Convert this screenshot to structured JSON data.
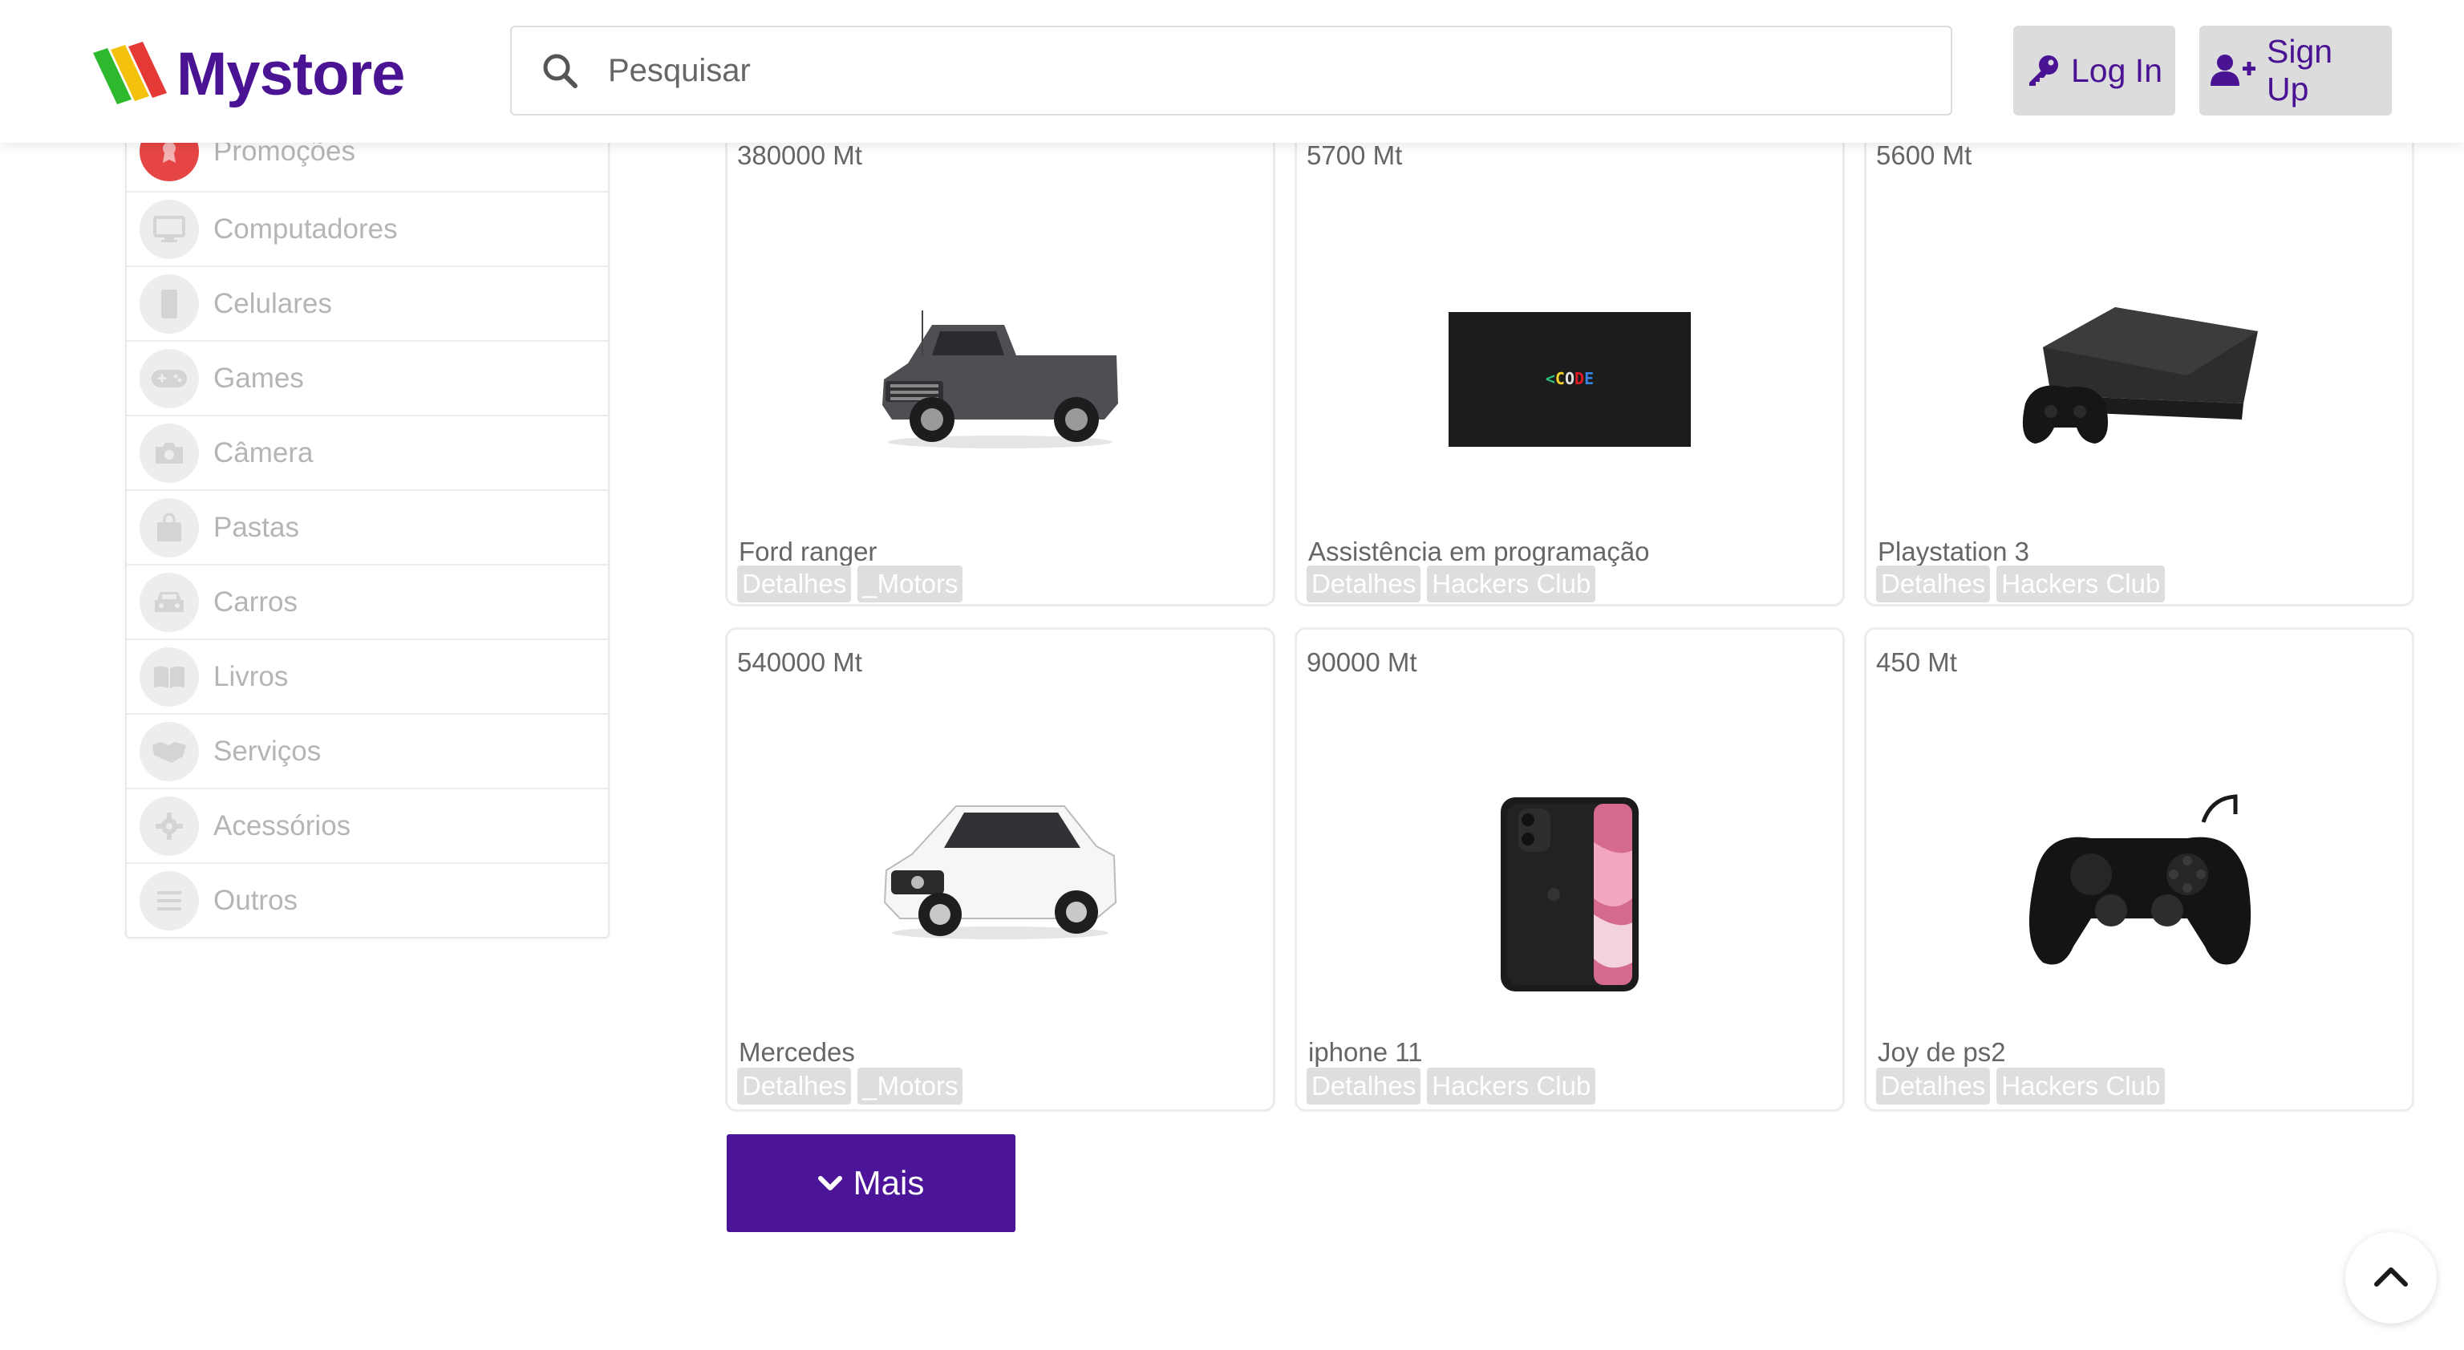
{
  "header": {
    "logo_text": "Mystore",
    "search_placeholder": "Pesquisar",
    "login_label": "Log In",
    "signup_label": "Sign Up"
  },
  "sidebar": {
    "items": [
      {
        "label": "Promoções",
        "icon": "award-icon"
      },
      {
        "label": "Computadores",
        "icon": "monitor-icon"
      },
      {
        "label": "Celulares",
        "icon": "mobile-icon"
      },
      {
        "label": "Games",
        "icon": "gamepad-icon"
      },
      {
        "label": "Câmera",
        "icon": "camera-icon"
      },
      {
        "label": "Pastas",
        "icon": "bag-icon"
      },
      {
        "label": "Carros",
        "icon": "car-icon"
      },
      {
        "label": "Livros",
        "icon": "book-icon"
      },
      {
        "label": "Serviços",
        "icon": "handshake-icon"
      },
      {
        "label": "Acessórios",
        "icon": "gear-icon"
      },
      {
        "label": "Outros",
        "icon": "list-icon"
      }
    ]
  },
  "products": [
    {
      "price": "380000 Mt",
      "name": "Ford ranger",
      "details": "Detalhes",
      "store": "_Motors",
      "image": "pickup-truck-image"
    },
    {
      "price": "5700 Mt",
      "name": "Assistência em programação",
      "details": "Detalhes",
      "store": "Hackers Club",
      "image": "code-banner-image"
    },
    {
      "price": "5600 Mt",
      "name": "Playstation 3",
      "details": "Detalhes",
      "store": "Hackers Club",
      "image": "ps3-console-image"
    },
    {
      "price": "540000 Mt",
      "name": "Mercedes",
      "details": "Detalhes",
      "store": "_Motors",
      "image": "suv-image"
    },
    {
      "price": "90000 Mt",
      "name": "iphone 11",
      "details": "Detalhes",
      "store": "Hackers Club",
      "image": "iphone-image"
    },
    {
      "price": "450 Mt",
      "name": "Joy de ps2",
      "details": "Detalhes",
      "store": "Hackers Club",
      "image": "ps2-controller-image"
    }
  ],
  "more_label": "Mais",
  "colors": {
    "brand": "#4a1394",
    "button_purple": "#4c1599",
    "tag_bg": "#dedede",
    "header_button_bg": "#dcdcdc"
  }
}
